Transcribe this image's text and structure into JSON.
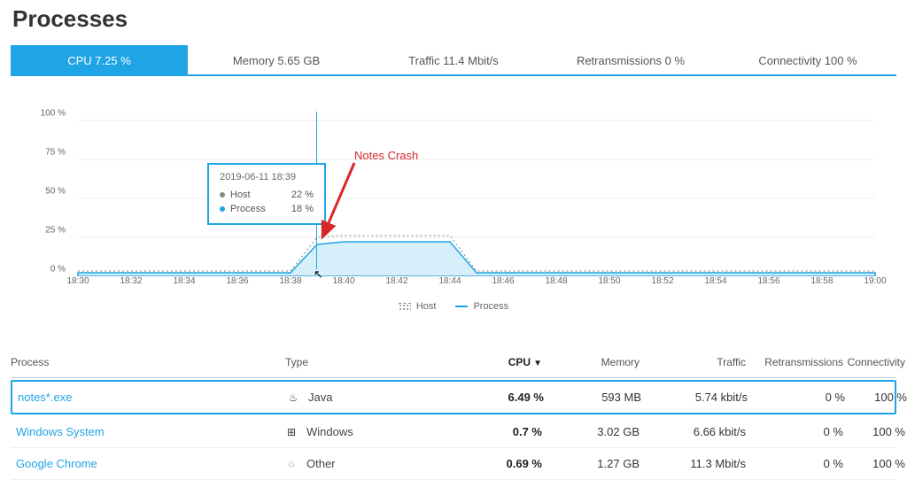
{
  "title": "Processes",
  "tabs": [
    {
      "label": "CPU 7.25 %",
      "active": true
    },
    {
      "label": "Memory 5.65 GB",
      "active": false
    },
    {
      "label": "Traffic 11.4 Mbit/s",
      "active": false
    },
    {
      "label": "Retransmissions 0 %",
      "active": false
    },
    {
      "label": "Connectivity 100 %",
      "active": false
    }
  ],
  "chart_data": {
    "type": "area",
    "title": "",
    "xlabel": "",
    "ylabel": "",
    "ylim": [
      0,
      100
    ],
    "y_ticks": [
      "0 %",
      "25 %",
      "50 %",
      "75 %",
      "100 %"
    ],
    "x_ticks": [
      "18:30",
      "18:32",
      "18:34",
      "18:36",
      "18:38",
      "18:40",
      "18:42",
      "18:44",
      "18:46",
      "18:48",
      "18:50",
      "18:52",
      "18:54",
      "18:56",
      "18:58",
      "19:00"
    ],
    "series": [
      {
        "name": "Host",
        "values": [
          3,
          3,
          3,
          3,
          3,
          22,
          22,
          22,
          3,
          3,
          3,
          3,
          3,
          3,
          3,
          3
        ]
      },
      {
        "name": "Process",
        "values": [
          2,
          2,
          2,
          2,
          2,
          18,
          20,
          20,
          2,
          2,
          2,
          2,
          2,
          2,
          2,
          2
        ]
      }
    ],
    "hover": {
      "time": "2019-06-11 18:39",
      "host": "22 %",
      "process": "18 %"
    },
    "annotation": "Notes Crash",
    "legend": {
      "host": "Host",
      "process": "Process"
    }
  },
  "table": {
    "headers": {
      "process": "Process",
      "type": "Type",
      "cpu": "CPU",
      "memory": "Memory",
      "traffic": "Traffic",
      "retransmissions": "Retransmissions",
      "connectivity": "Connectivity"
    },
    "sort_indicator": "▼",
    "rows": [
      {
        "process": "notes*.exe",
        "type": "Java",
        "icon": "java",
        "cpu": "6.49 %",
        "memory": "593 MB",
        "traffic": "5.74 kbit/s",
        "retransmissions": "0 %",
        "connectivity": "100 %",
        "highlight": true
      },
      {
        "process": "Windows System",
        "type": "Windows",
        "icon": "windows",
        "cpu": "0.7 %",
        "memory": "3.02 GB",
        "traffic": "6.66 kbit/s",
        "retransmissions": "0 %",
        "connectivity": "100 %",
        "highlight": false
      },
      {
        "process": "Google Chrome",
        "type": "Other",
        "icon": "other",
        "cpu": "0.69 %",
        "memory": "1.27 GB",
        "traffic": "11.3 Mbit/s",
        "retransmissions": "0 %",
        "connectivity": "100 %",
        "highlight": false
      }
    ]
  },
  "icons": {
    "java": "♨",
    "windows": "⊞",
    "other": "◌"
  }
}
